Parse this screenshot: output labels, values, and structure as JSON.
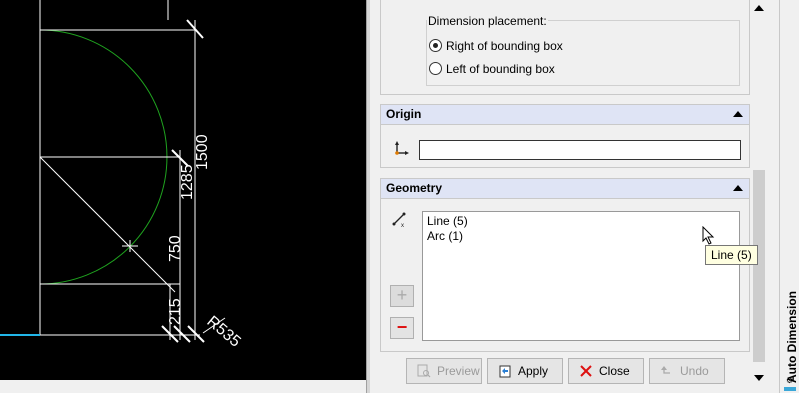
{
  "viewport": {
    "dimensions": [
      "1500",
      "1285",
      "750",
      "215",
      "R535"
    ]
  },
  "panel": {
    "dimension_placement": {
      "title": "Dimension placement:",
      "options": [
        {
          "label": "Right of bounding box",
          "selected": true
        },
        {
          "label": "Left of bounding box",
          "selected": false
        }
      ]
    },
    "origin": {
      "title": "Origin",
      "value": ""
    },
    "geometry": {
      "title": "Geometry",
      "items": [
        "Line (5)",
        "Arc (1)"
      ]
    },
    "buttons": {
      "preview": "Preview",
      "apply": "Apply",
      "close": "Close",
      "undo": "Undo"
    },
    "tooltip": "Line (5)"
  },
  "sidetab": {
    "label": "Auto Dimension"
  },
  "colors": {
    "accent": "#22b6e8",
    "header_bg": "#dfe4f5",
    "delete_red": "#d11111"
  }
}
